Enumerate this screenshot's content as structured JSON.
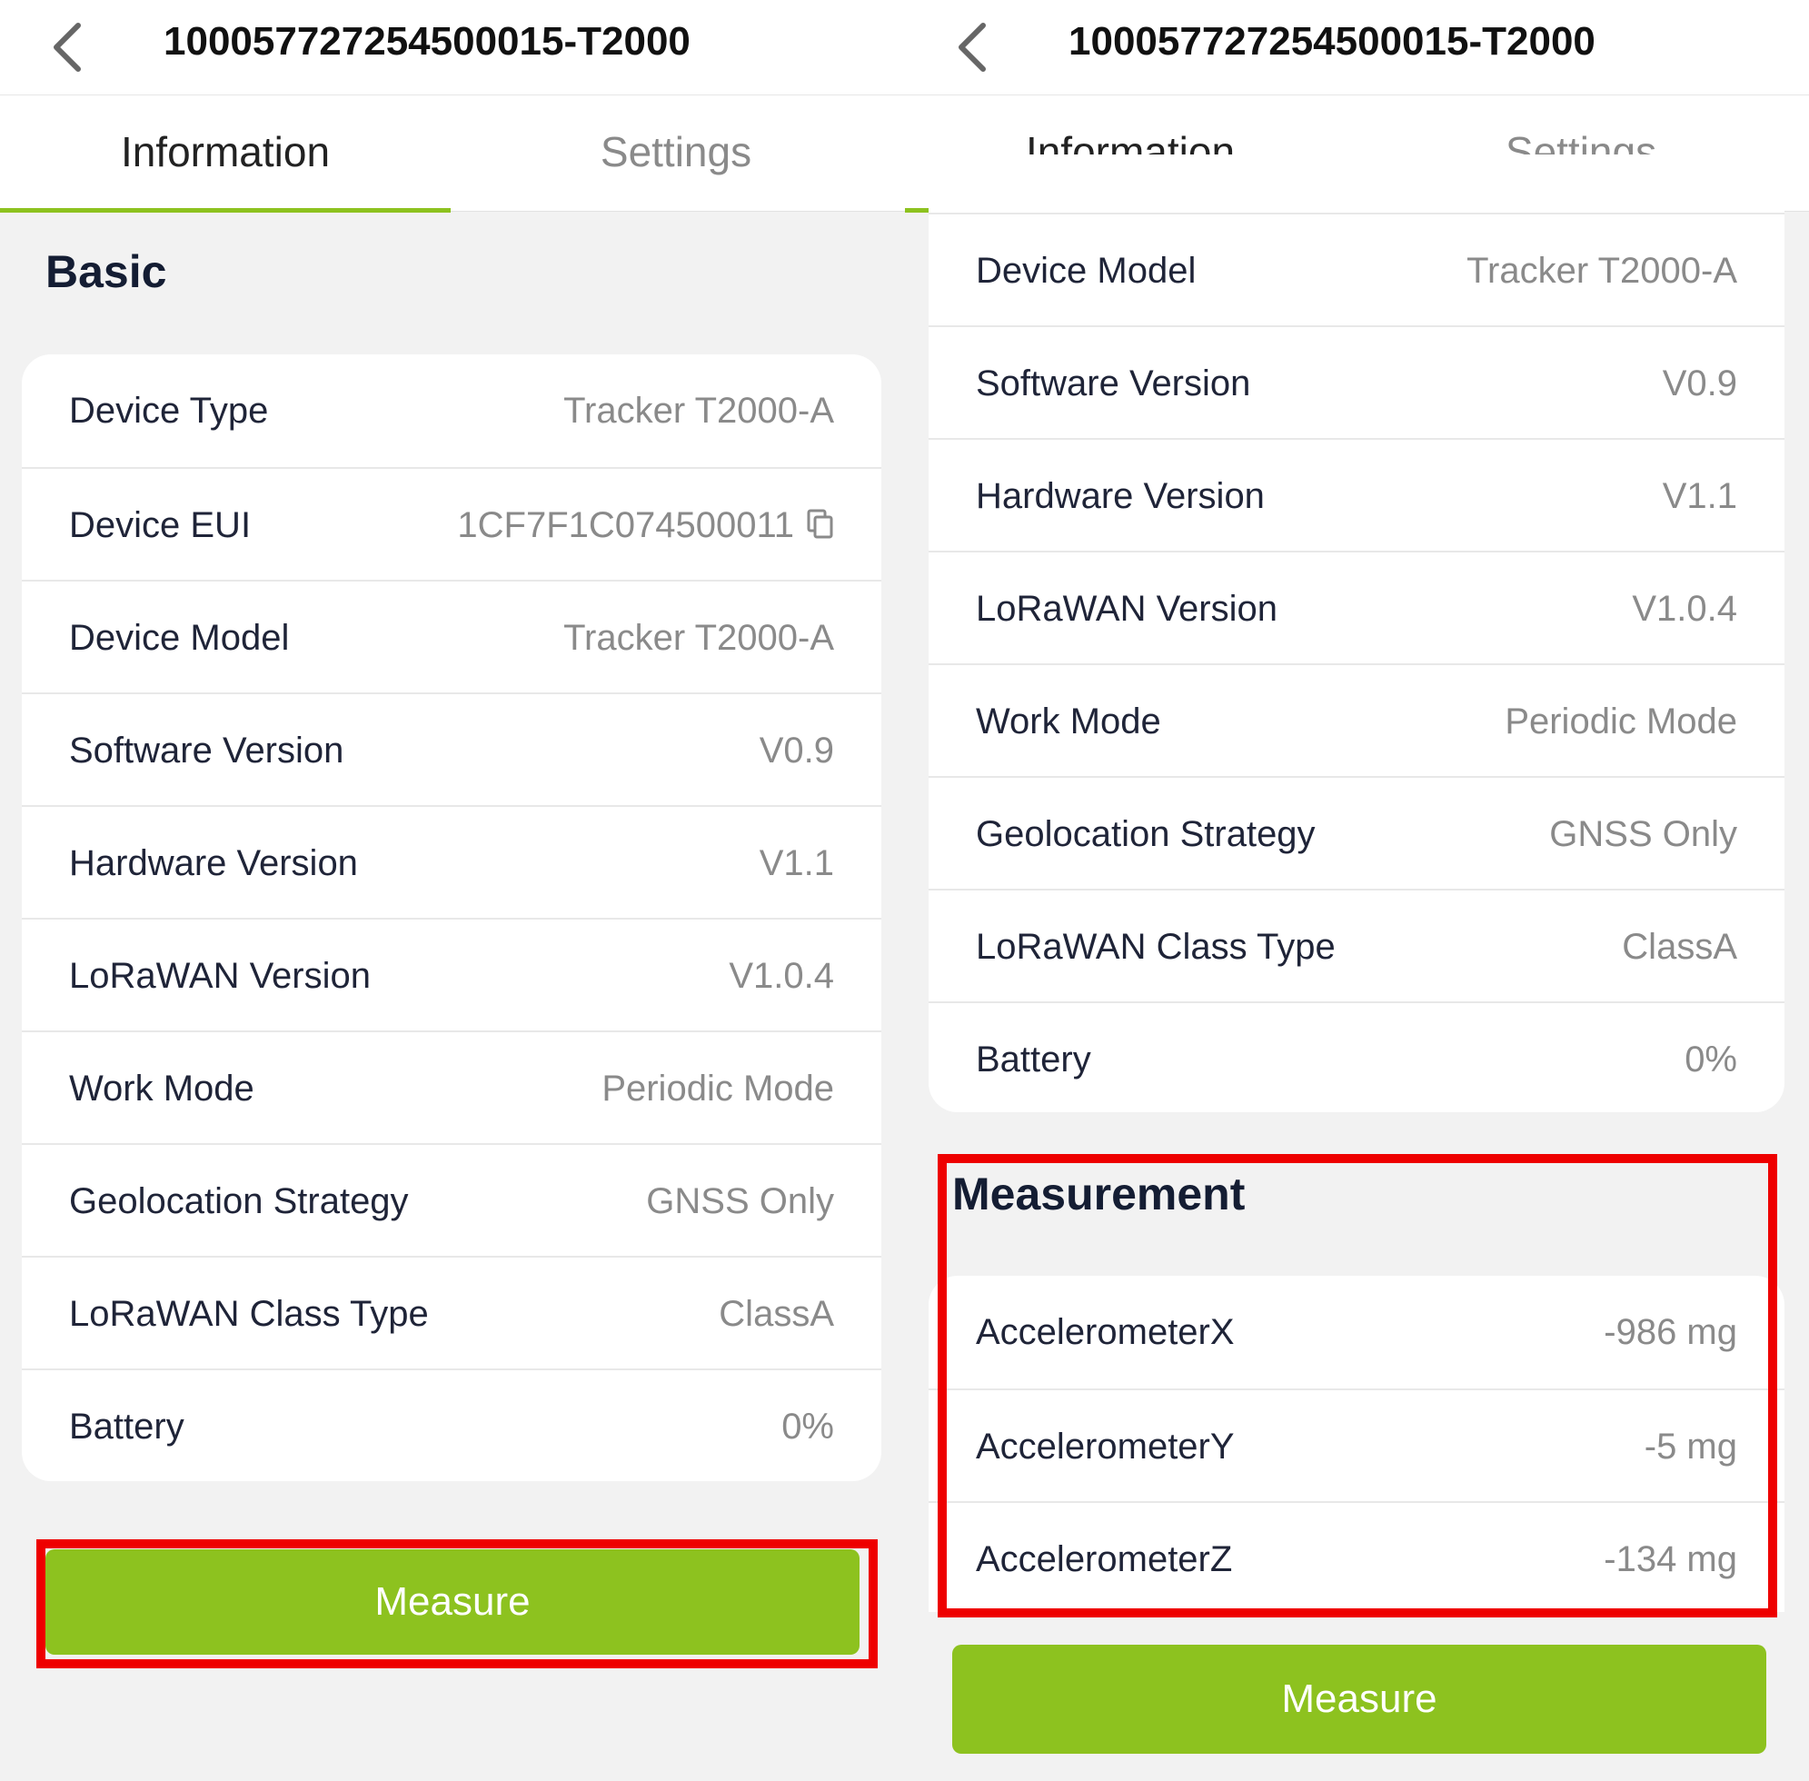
{
  "colors": {
    "accent": "#8dc21f",
    "highlight": "#ee0000"
  },
  "left": {
    "header": {
      "title": "10005772725450001​5-T2000",
      "back_icon": "chevron-left-icon"
    },
    "tabs": [
      {
        "label": "Information",
        "active": true
      },
      {
        "label": "Settings",
        "active": false
      }
    ],
    "basic": {
      "title": "Basic",
      "rows": [
        {
          "label": "Device Type",
          "value": "Tracker T2000-A"
        },
        {
          "label": "Device EUI",
          "value": "1CF7F1C074500011"
        },
        {
          "label": "Device Model",
          "value": "Tracker T2000-A"
        },
        {
          "label": "Software Version",
          "value": "V0.9"
        },
        {
          "label": "Hardware Version",
          "value": "V1.1"
        },
        {
          "label": "LoRaWAN Version",
          "value": "V1.0.4"
        },
        {
          "label": "Work Mode",
          "value": "Periodic Mode"
        },
        {
          "label": "Geolocation Strategy",
          "value": "GNSS Only"
        },
        {
          "label": "LoRaWAN Class Type",
          "value": "ClassA"
        },
        {
          "label": "Battery",
          "value": "0%"
        }
      ]
    },
    "measure_button": "Measure"
  },
  "right": {
    "header": {
      "title": "10005772725450001​5-T2000",
      "back_icon": "chevron-left-icon"
    },
    "tabs": [
      {
        "label": "Information",
        "active": true
      },
      {
        "label": "Settings",
        "active": false
      }
    ],
    "basic_rows": [
      {
        "label": "Device Model",
        "value": "Tracker T2000-A"
      },
      {
        "label": "Software Version",
        "value": "V0.9"
      },
      {
        "label": "Hardware Version",
        "value": "V1.1"
      },
      {
        "label": "LoRaWAN Version",
        "value": "V1.0.4"
      },
      {
        "label": "Work Mode",
        "value": "Periodic Mode"
      },
      {
        "label": "Geolocation Strategy",
        "value": "GNSS Only"
      },
      {
        "label": "LoRaWAN Class Type",
        "value": "ClassA"
      },
      {
        "label": "Battery",
        "value": "0%"
      }
    ],
    "measurement": {
      "title": "Measurement",
      "rows": [
        {
          "label": "AccelerometerX",
          "value": "-986 mg"
        },
        {
          "label": "AccelerometerY",
          "value": "-5 mg"
        },
        {
          "label": "AccelerometerZ",
          "value": "-134 mg"
        }
      ]
    },
    "measure_button": "Measure"
  }
}
